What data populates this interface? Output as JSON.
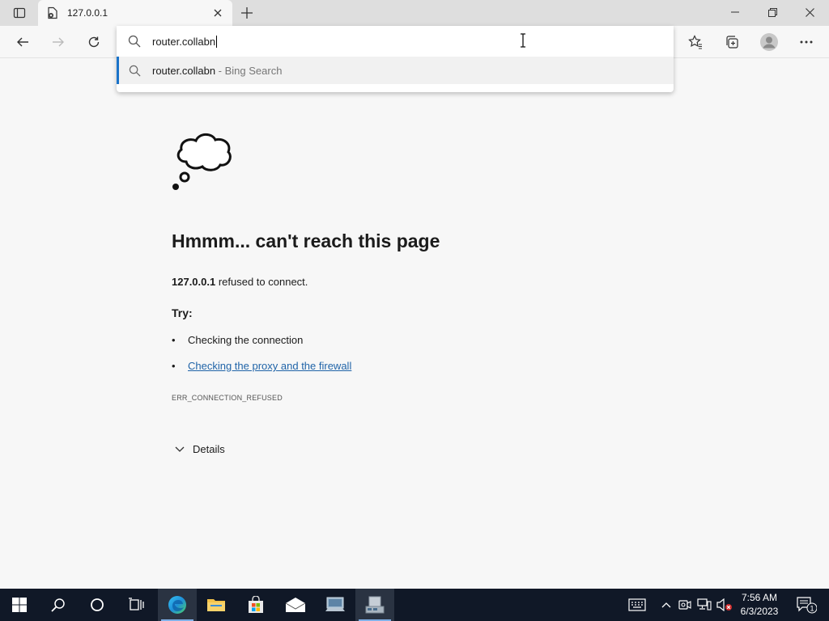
{
  "browser": {
    "tab": {
      "title": "127.0.0.1"
    },
    "address_bar": {
      "value": "router.collabn"
    },
    "suggestions": [
      {
        "query": "router.collabn",
        "source": "Bing Search",
        "separator": " - "
      }
    ]
  },
  "error_page": {
    "headline": "Hmmm... can't reach this page",
    "host": "127.0.0.1",
    "refused_text": " refused to connect.",
    "try_label": "Try:",
    "bullet_char": "•",
    "suggestions": [
      {
        "text": "Checking the connection",
        "is_link": false
      },
      {
        "text": "Checking the proxy and the firewall",
        "is_link": true
      }
    ],
    "error_code": "ERR_CONNECTION_REFUSED",
    "details_label": "Details"
  },
  "taskbar": {
    "time": "7:56 AM",
    "date": "6/3/2023",
    "notification_count": "1",
    "pinned_icons": [
      "windows-start-icon",
      "search-icon",
      "cortana-icon",
      "task-view-icon",
      "edge-icon",
      "file-explorer-icon",
      "store-icon",
      "mail-icon",
      "server-manager-icon",
      "network-app-icon"
    ]
  },
  "colors": {
    "link": "#2064a8",
    "suggestion_accent": "#1a73c9",
    "taskbar_bg": "#101827",
    "page_bg": "#f7f7f7"
  }
}
